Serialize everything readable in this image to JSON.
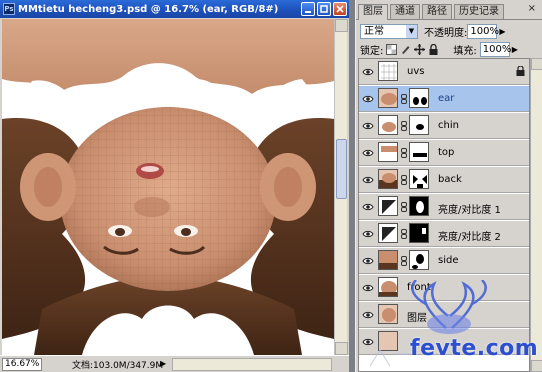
{
  "document": {
    "title": "MMtietu hecheng3.psd @ 16.7% (ear, RGB/8#)",
    "status": {
      "zoom": "16.67%",
      "doc_info": "文档:103.0M/347.9M"
    }
  },
  "panel": {
    "tabs": [
      {
        "label": "图层",
        "active": true
      },
      {
        "label": "通道",
        "active": false
      },
      {
        "label": "路径",
        "active": false
      },
      {
        "label": "历史记录",
        "active": false
      }
    ],
    "close_glyph": "×",
    "blend_mode": "正常",
    "opacity_label": "不透明度:",
    "opacity_value": "100%",
    "lock_label": "锁定:",
    "fill_label": "填充:",
    "fill_value": "100%",
    "layers": [
      {
        "name": "uvs",
        "visible": true,
        "selected": false,
        "has_mask": false,
        "locked": true
      },
      {
        "name": "ear",
        "visible": true,
        "selected": true,
        "has_mask": true,
        "locked": false
      },
      {
        "name": "chin",
        "visible": true,
        "selected": false,
        "has_mask": true,
        "locked": false
      },
      {
        "name": "top",
        "visible": true,
        "selected": false,
        "has_mask": true,
        "locked": false
      },
      {
        "name": "back",
        "visible": true,
        "selected": false,
        "has_mask": true,
        "locked": false
      },
      {
        "name": "亮度/对比度 1",
        "visible": true,
        "selected": false,
        "has_mask": true,
        "locked": false
      },
      {
        "name": "亮度/对比度 2",
        "visible": true,
        "selected": false,
        "has_mask": true,
        "locked": false
      },
      {
        "name": "side",
        "visible": true,
        "selected": false,
        "has_mask": true,
        "locked": false
      },
      {
        "name": "front",
        "visible": true,
        "selected": false,
        "has_mask": true,
        "locked": false
      },
      {
        "name": "图层",
        "visible": true,
        "selected": false,
        "has_mask": false,
        "locked": false
      }
    ]
  },
  "watermark": {
    "site": "fevte.com"
  },
  "colors": {
    "title_bar": "#1d4fb8",
    "selected_layer": "#a7c5ec",
    "panel_bg": "#d6d3ce",
    "skin": "#c98e6e",
    "hair": "#5a3620"
  }
}
